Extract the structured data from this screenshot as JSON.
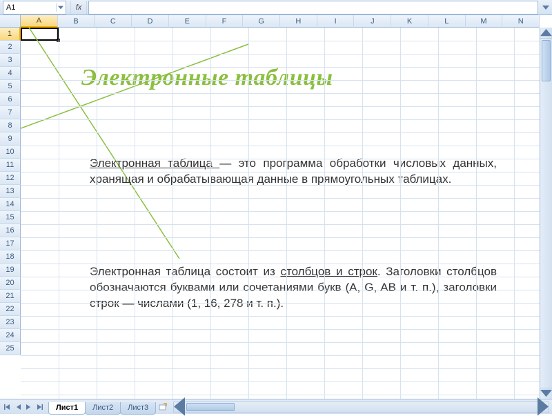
{
  "name_box": {
    "value": "A1"
  },
  "formula_bar": {
    "fx_label": "fx",
    "value": ""
  },
  "columns": [
    "A",
    "B",
    "C",
    "D",
    "E",
    "F",
    "G",
    "H",
    "I",
    "J",
    "K",
    "L",
    "M",
    "N"
  ],
  "selected_column_index": 0,
  "rows": [
    "1",
    "2",
    "3",
    "4",
    "5",
    "6",
    "7",
    "8",
    "9",
    "10",
    "11",
    "12",
    "13",
    "14",
    "15",
    "16",
    "17",
    "18",
    "19",
    "20",
    "21",
    "22",
    "23",
    "24",
    "25"
  ],
  "selected_row_index": 0,
  "selected_cell": "A1",
  "content": {
    "title": "Электронные таблицы",
    "p1_u": "Электронная таблица ",
    "p1_rest": "— это программа обработки числовых данных, хранящая и обрабатывающая данные в прямоугольных таблицах.",
    "p2_a": "Электронная таблица состоит из ",
    "p2_u": "столбцов и строк",
    "p2_b": ". Заголовки столбцов обозначаются буквами или сочетаниями букв (A, G, AB и т. п.), заголовки строк — числами (1, 16, 278 и т. п.)."
  },
  "sheet_tabs": {
    "items": [
      "Лист1",
      "Лист2",
      "Лист3"
    ],
    "active_index": 0
  },
  "colors": {
    "title": "#8bbf3f",
    "line": "#8bbf3f"
  }
}
